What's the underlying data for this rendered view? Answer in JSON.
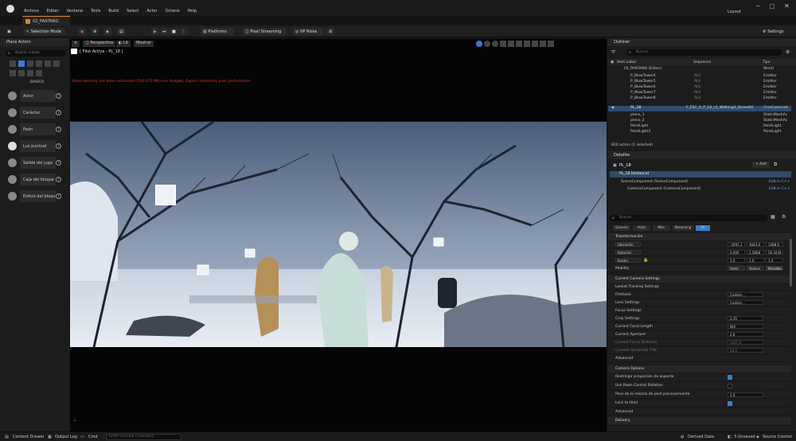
{
  "app": {
    "tab_name": "02_PANTANO",
    "layout_label": "Layout"
  },
  "menu": [
    "Archivo",
    "Editar",
    "Ventana",
    "Tools",
    "Build",
    "Select",
    "Actor",
    "Octane",
    "Help"
  ],
  "toolbar": {
    "selection_mode": "Selection Mode",
    "platforms": "Platforms",
    "pixel_streaming": "Pixel Streaming",
    "vp_roles": "VP Roles",
    "settings": "Settings"
  },
  "place_actors": {
    "title": "Place Actors",
    "search_placeholder": "Buscar clases",
    "category": "BASICO",
    "items": [
      "Actor",
      "Carácter",
      "Peón",
      "Luz puntual",
      "Salida del juga",
      "Caja del bloque",
      "Esfera del bloqu"
    ]
  },
  "viewport": {
    "perspective": "Perspective",
    "lit": "Lit",
    "show": "Mostrar",
    "pilot_label": "[ Pilot Active - PL_18 ]",
    "warning": "Video memory has been exhausted (560.973 MB over budget). Expect extremely poor performance."
  },
  "outliner": {
    "title": "Outliner",
    "search_placeholder": "Buscar",
    "col_label": "Item Label",
    "col_sequence": "Sequence",
    "col_type": "Tipo",
    "rows": [
      {
        "label": "02_PANTANO (Editor)",
        "seq": "",
        "type": "World"
      },
      {
        "label": "P_BlowTower4",
        "seq": "ALV",
        "type": "Emitter"
      },
      {
        "label": "P_BlowTower5",
        "seq": "ALV",
        "type": "Emitter"
      },
      {
        "label": "P_BlowTower6",
        "seq": "ALV",
        "type": "Emitter"
      },
      {
        "label": "P_BlowTower7",
        "seq": "ALV",
        "type": "Emitter"
      },
      {
        "label": "P_BlowTower8",
        "seq": "ALV",
        "type": "Emitter"
      },
      {
        "label": "PL_18",
        "seq": "F_ESC_A_P_18_v1_Walking3_Dronv04",
        "type": "CineCameraA"
      },
      {
        "label": "plano_1",
        "seq": "",
        "type": "StaticMeshAc"
      },
      {
        "label": "plano_2",
        "seq": "",
        "type": "StaticMeshAc"
      },
      {
        "label": "PointLight",
        "seq": "",
        "type": "PointLight"
      },
      {
        "label": "PointLight3",
        "seq": "",
        "type": "PointLight"
      }
    ],
    "count": "820 actors (1 selected)"
  },
  "details": {
    "title": "Detalles",
    "actor_name": "PL_18",
    "add_button": "+ Add",
    "instance": "PL_18 (Instance)",
    "scene_component": "SceneComponent (SceneComponent)",
    "camera_component": "CameraComponent (CameraComponent)",
    "edit_cpp": "Edit in C++",
    "search_placeholder": "Buscar",
    "tabs": [
      "General",
      "Actor",
      "Misc",
      "Streaming",
      "All"
    ],
    "transform_header": "Transformación",
    "location_label": "Ubicación",
    "location": [
      "-3291.1",
      "4643.0",
      "1488.6"
    ],
    "rotation_label": "Rotación",
    "rotation": [
      "0.000",
      "2.5808",
      "56.3439"
    ],
    "scale_label": "Escala",
    "scale": [
      "1.0",
      "1.0",
      "1.0"
    ],
    "mobility_label": "Mobility",
    "mobility": [
      "Static",
      "Station",
      "Movable"
    ],
    "camera_settings_header": "Current Camera Settings",
    "lookat": "Lookat Tracking Settings",
    "filmback_label": "Filmback",
    "filmback_value": "Custom...",
    "lens_label": "Lens Settings",
    "lens_value": "Custom...",
    "focus_label": "Focus Settings",
    "crop_label": "Crop Settings",
    "crop_value": "2.35",
    "focal_label": "Current Focal Length",
    "focal_value": "N/A",
    "aperture_label": "Current Aperture",
    "aperture_value": "2.8",
    "focus_dist_label": "Current Focus Distance",
    "focus_dist_value": "1257.0",
    "hfov_label": "Current Horizontal FOV",
    "hfov_value": "64.0",
    "advanced": "Advanced",
    "camera_options_header": "Camera Options",
    "opt1": "Restringir proporción de aspecto",
    "opt2": "Use Pawn Control Rotation",
    "opt3": "Peso de la mezcla de post procesamiento",
    "opt3_value": "1.0",
    "opt4": "Lock to Hmd",
    "advanced2": "Advanced",
    "rendering_header": "Delivery"
  },
  "statusbar": {
    "content_drawer": "Content Drawer",
    "output_log": "Output Log",
    "cmd": "Cmd",
    "cmd_placeholder": "Enter Console Command",
    "derived": "Derived Data",
    "unsaved": "3 Unsaved",
    "source": "Source Control"
  }
}
